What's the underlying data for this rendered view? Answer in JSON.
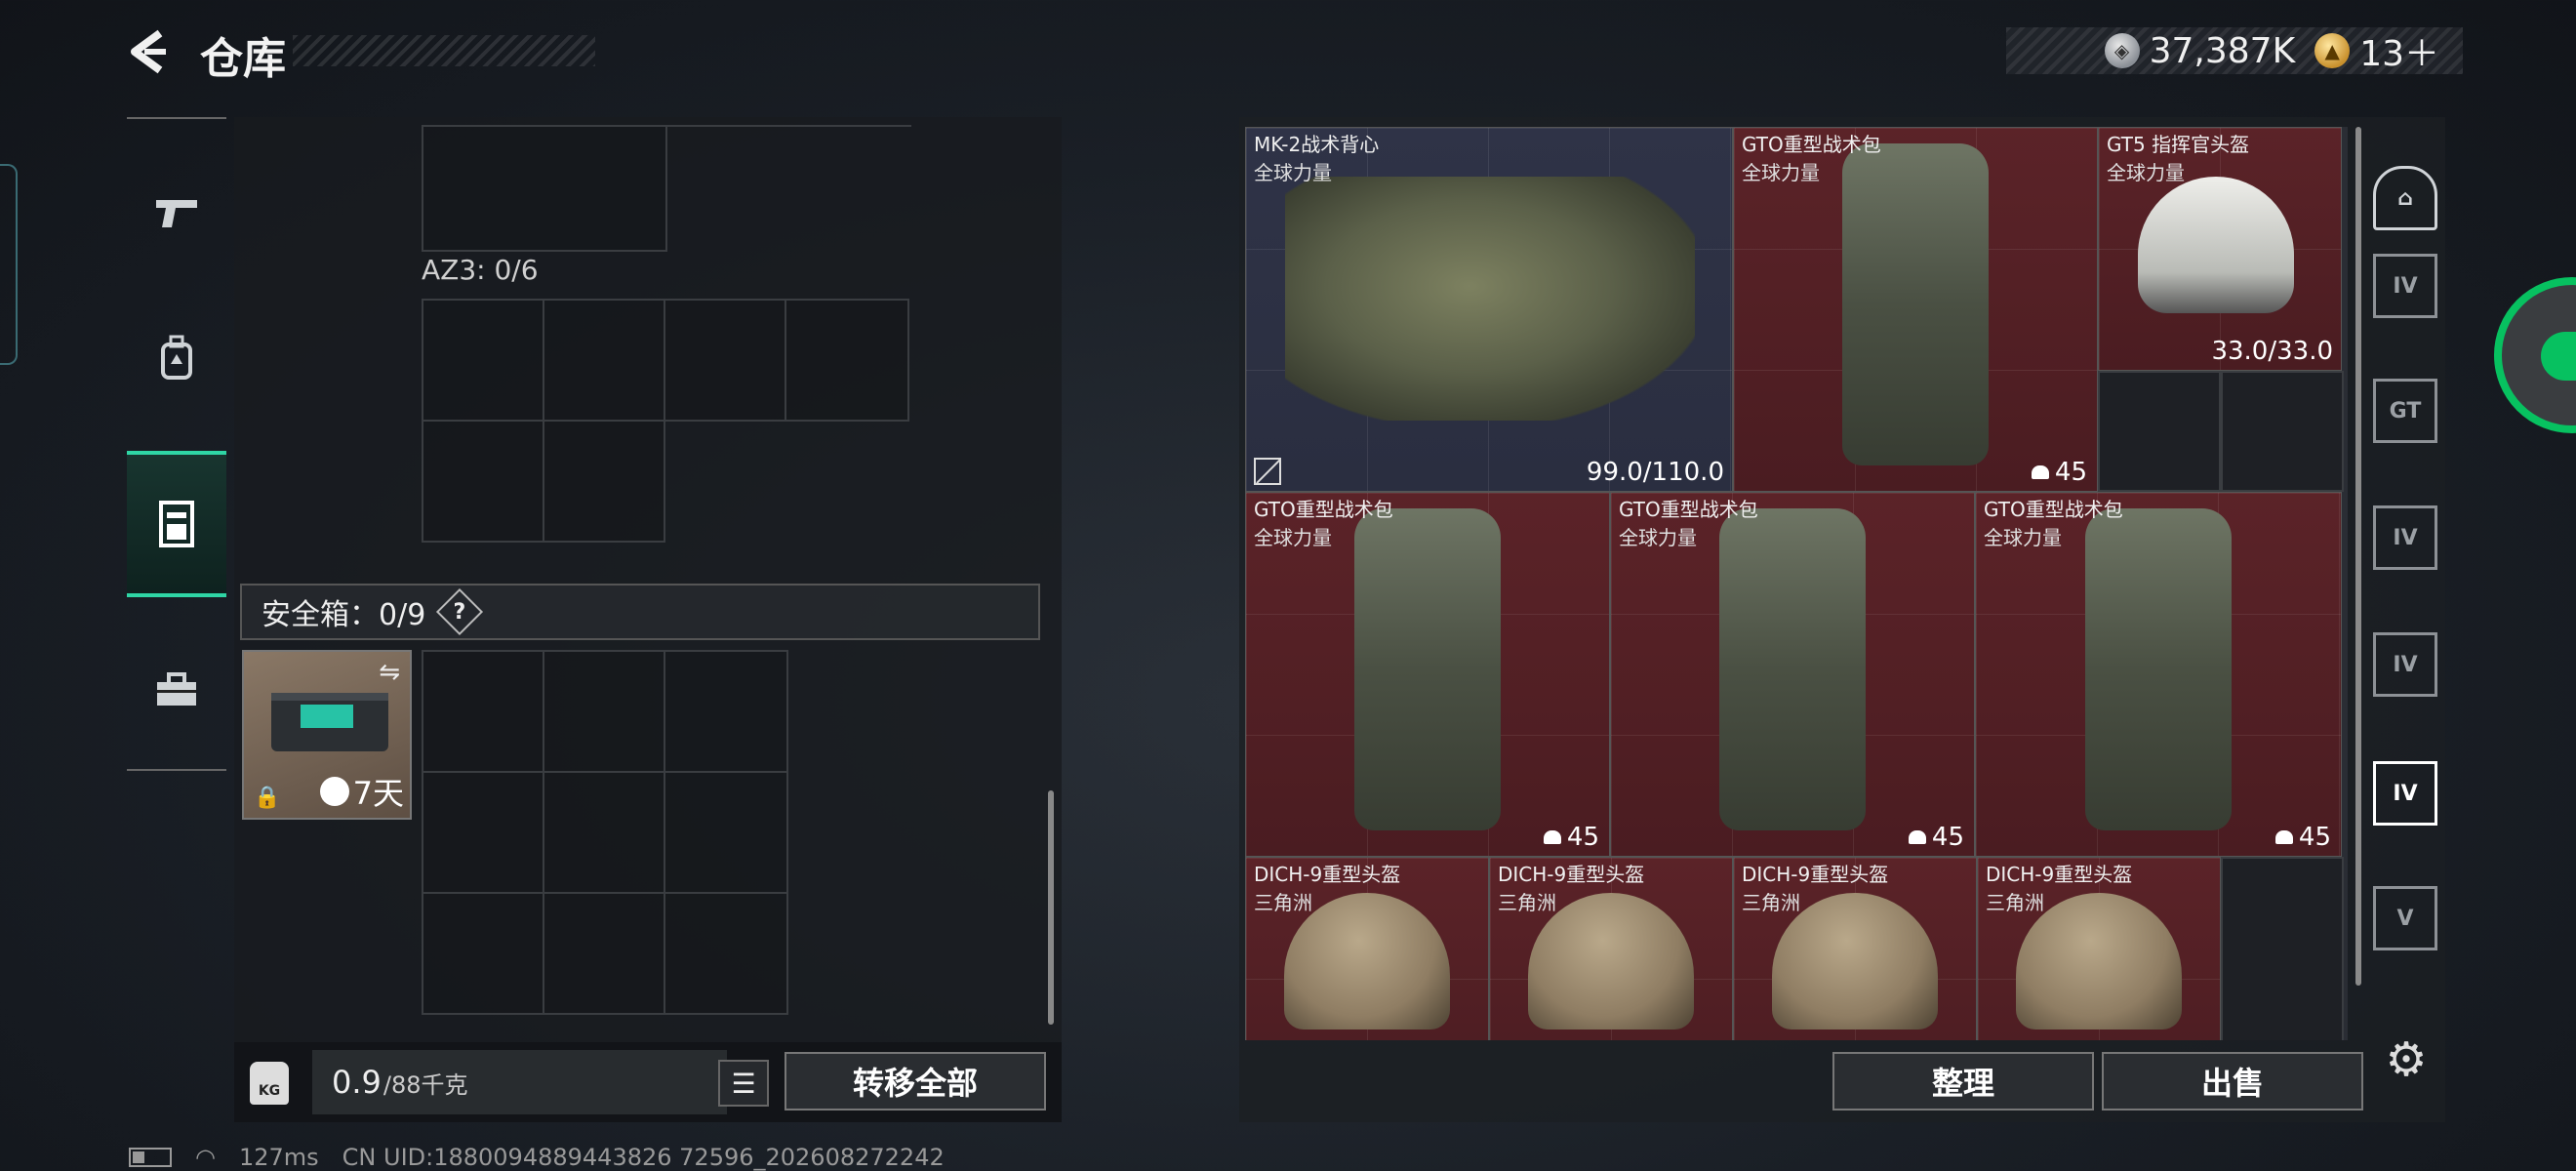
{
  "header": {
    "title": "仓库",
    "currency_silver": "37,387K",
    "currency_gold": "13＋"
  },
  "left_nav": {
    "items": [
      {
        "name": "weapons",
        "icon": "pistol-icon"
      },
      {
        "name": "backpack",
        "icon": "backpack-icon"
      },
      {
        "name": "storage",
        "icon": "locker-icon",
        "active": true
      },
      {
        "name": "toolbox",
        "icon": "toolbox-icon"
      }
    ]
  },
  "storage": {
    "az3_label": "AZ3: 0/6",
    "safe_box_label": "安全箱：0/9",
    "safe_box_help": "?",
    "safe_item_time": "7天",
    "weight_value": "0.9",
    "weight_unit": "/88千克",
    "kg_label": "KG",
    "transfer_all": "转移全部"
  },
  "status": {
    "ping": "127ms",
    "uid": "CN UID:1880094889443826 72596_202608272242"
  },
  "inventory": {
    "items": [
      {
        "name": "MK-2战术背心",
        "sub": "全球力量",
        "value": "99.0/110.0",
        "kind": "vest"
      },
      {
        "name": "GTO重型战术包",
        "sub": "全球力量",
        "value": "45",
        "kind": "pack"
      },
      {
        "name": "GT5 指挥官头盔",
        "sub": "全球力量",
        "value": "33.0/33.0",
        "kind": "helmet"
      },
      {
        "name": "GTO重型战术包",
        "sub": "全球力量",
        "value": "45",
        "kind": "pack"
      },
      {
        "name": "GTO重型战术包",
        "sub": "全球力量",
        "value": "45",
        "kind": "pack"
      },
      {
        "name": "GTO重型战术包",
        "sub": "全球力量",
        "value": "45",
        "kind": "pack"
      },
      {
        "name": "DICH-9重型头盔",
        "sub": "三角洲",
        "kind": "helmet"
      },
      {
        "name": "DICH-9重型头盔",
        "sub": "三角洲",
        "kind": "helmet"
      },
      {
        "name": "DICH-9重型头盔",
        "sub": "三角洲",
        "kind": "helmet"
      },
      {
        "name": "DICH-9重型头盔",
        "sub": "三角洲",
        "kind": "helmet"
      }
    ],
    "sort_label": "整理",
    "sell_label": "出售"
  },
  "filters": {
    "items": [
      "IV",
      "GT",
      "IV",
      "IV",
      "IV",
      "V"
    ]
  }
}
